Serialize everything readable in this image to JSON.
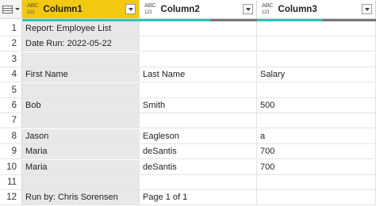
{
  "columns": [
    {
      "type": "ABC",
      "type_sub": "123",
      "name": "Column1",
      "selected": true
    },
    {
      "type": "ABC",
      "type_sub": "123",
      "name": "Column2",
      "selected": false
    },
    {
      "type": "ABC",
      "type_sub": "123",
      "name": "Column3",
      "selected": false
    }
  ],
  "quality": [
    {
      "valid_fraction": 1.0,
      "error_fraction": 0.0
    },
    {
      "valid_fraction": 0.6,
      "error_fraction": 0.4
    },
    {
      "valid_fraction": 0.55,
      "error_fraction": 0.45
    }
  ],
  "rows": [
    {
      "n": "1",
      "c1": "Report: Employee List",
      "c2": "",
      "c3": ""
    },
    {
      "n": "2",
      "c1": "Date Run: 2022-05-22",
      "c2": "",
      "c3": ""
    },
    {
      "n": "3",
      "c1": "",
      "c2": "",
      "c3": ""
    },
    {
      "n": "4",
      "c1": "First Name",
      "c2": "Last Name",
      "c3": "Salary"
    },
    {
      "n": "5",
      "c1": "",
      "c2": "",
      "c3": ""
    },
    {
      "n": "6",
      "c1": "Bob",
      "c2": "Smith",
      "c3": "500"
    },
    {
      "n": "7",
      "c1": "",
      "c2": "",
      "c3": ""
    },
    {
      "n": "8",
      "c1": "Jason",
      "c2": "Eagleson",
      "c3": "a"
    },
    {
      "n": "9",
      "c1": "Maria",
      "c2": "deSantis",
      "c3": "700"
    },
    {
      "n": "10",
      "c1": "Maria",
      "c2": "deSantis",
      "c3": "700"
    },
    {
      "n": "11",
      "c1": "",
      "c2": "",
      "c3": ""
    },
    {
      "n": "12",
      "c1": "Run by: Chris Sorensen",
      "c2": "Page 1 of 1",
      "c3": ""
    }
  ],
  "colors": {
    "selected_header": "#f2c811",
    "valid": "#2ec4b6",
    "error": "#777777",
    "selected_column_bg": "#e8e8e8"
  }
}
